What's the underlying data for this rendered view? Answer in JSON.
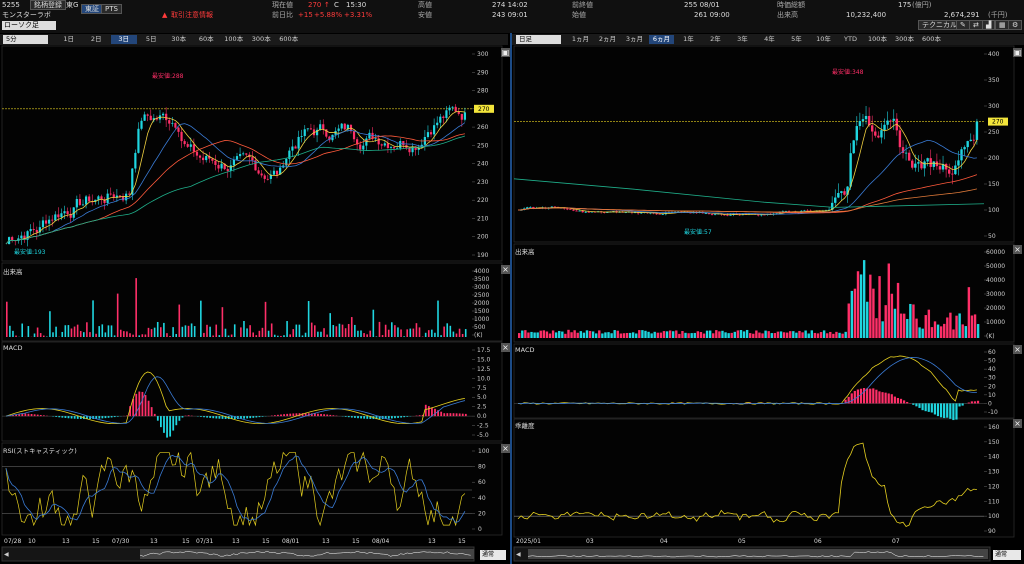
{
  "header": {
    "code": "5255",
    "ticker_btn": "銘柄登録",
    "exchange": "東G",
    "market_btn": "東証",
    "pts_btn": "PTS",
    "name": "モンスターラボ",
    "view": "ローソク足",
    "alert": "取引注意情報",
    "price_label": "現在値",
    "price": "270",
    "change_label": "前日比",
    "change": "+15",
    "change_pct": "+5.88%",
    "change_pct2": "+3.31%",
    "time": "15:30",
    "c_mark": "C",
    "high_label": "高値",
    "high": "274 14:02",
    "low_label": "安値",
    "low": "243 09:01",
    "prev_label": "前終値",
    "prev": "255 08/01",
    "open_label": "始値",
    "open": "261 09:00",
    "mcap_label": "時価総額",
    "mcap": "175",
    "mcap_unit": "(億円)",
    "vol_label": "出来高",
    "vol": "10,232,400",
    "value": "2,674,291",
    "value_unit": "(千円)",
    "tech_btn": "テクニカル"
  },
  "left": {
    "interval": "5分",
    "periods": [
      "1日",
      "2日",
      "3日",
      "5日",
      "30本",
      "60本",
      "100本",
      "300本",
      "600本"
    ],
    "selected_period": "3日",
    "price_ticks": [
      "300",
      "290",
      "280",
      "270",
      "260",
      "250",
      "240",
      "230",
      "220",
      "210",
      "200",
      "190"
    ],
    "high_mark": "最安値:288",
    "low_mark": "最安値:193",
    "current": "270",
    "volume_title": "出来高",
    "volume_ticks": [
      "4000",
      "3500",
      "3000",
      "2500",
      "2000",
      "1500",
      "1000",
      "500",
      "(K)"
    ],
    "macd_title": "MACD",
    "macd_ticks": [
      "17.5",
      "15.0",
      "12.5",
      "10.0",
      "7.5",
      "5.0",
      "2.5",
      "0.0",
      "-2.5",
      "-5.0"
    ],
    "rsi_title": "RSI(ストキャスティック)",
    "rsi_ticks": [
      "100",
      "80",
      "60",
      "40",
      "20",
      "0"
    ],
    "x_labels": [
      "07/28",
      "10",
      "13",
      "15",
      "07/30",
      "13",
      "15",
      "07/31",
      "13",
      "15",
      "08/01",
      "13",
      "15",
      "08/04",
      "13",
      "15"
    ],
    "scroll_select": "通常"
  },
  "right": {
    "interval": "日足",
    "periods": [
      "1ヵ月",
      "2ヵ月",
      "3ヵ月",
      "6ヵ月",
      "1年",
      "2年",
      "3年",
      "4年",
      "5年",
      "10年",
      "YTD",
      "100本",
      "300本",
      "600本"
    ],
    "selected_period": "6ヵ月",
    "price_ticks": [
      "400",
      "350",
      "300",
      "250",
      "200",
      "150",
      "100",
      "50"
    ],
    "high_mark": "最安値:348",
    "low_mark": "最安値:57",
    "current": "270",
    "volume_title": "出来高",
    "volume_ticks": [
      "60000",
      "50000",
      "40000",
      "30000",
      "20000",
      "10000",
      "(K)"
    ],
    "macd_title": "MACD",
    "macd_ticks": [
      "60",
      "50",
      "40",
      "30",
      "20",
      "10",
      "0",
      "-10"
    ],
    "ind_title": "乖離度",
    "ind_ticks": [
      "160",
      "150",
      "140",
      "130",
      "120",
      "110",
      "100",
      "90"
    ],
    "x_labels": [
      "2025/01",
      "03",
      "04",
      "05",
      "06",
      "07"
    ],
    "scroll_select": "通常"
  },
  "colors": {
    "up": "#1fd6e0",
    "down": "#ff2f68",
    "bg": "#000000",
    "accent": "#23467a",
    "yellow": "#e6d020"
  }
}
